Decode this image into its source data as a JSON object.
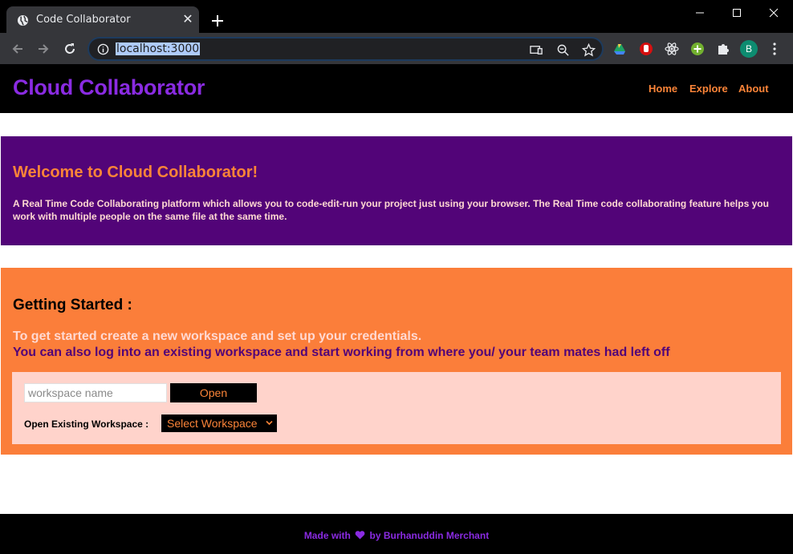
{
  "browser": {
    "tab_title": "Code Collaborator",
    "url": "localhost:3000",
    "profile_initial": "B"
  },
  "header": {
    "brand": "Cloud Collaborator",
    "nav": [
      "Home",
      "Explore",
      "About"
    ]
  },
  "welcome": {
    "title": "Welcome to Cloud Collaborator!",
    "text": "A Real Time Code Collaborating platform which allows you to code-edit-run your project just using your browser. The Real Time code collaborating feature helps you work with multiple people on the same file at the same time."
  },
  "getting_started": {
    "title": "Getting Started :",
    "line1": "To get started create a new workspace and set up your credentials.",
    "line2": "You can also log into an existing workspace and start working from where you/ your team mates had left off",
    "input_placeholder": "workspace name",
    "open_label": "Open",
    "existing_label": "Open Existing Workspace :",
    "select_value": "Select Workspace"
  },
  "footer": {
    "made_with": "Made with",
    "by": "by Burhanuddin Merchant"
  },
  "colors": {
    "purple": "#8a2be2",
    "deep_purple": "#520478",
    "orange": "#fb8438",
    "peach": "#ffd3cb"
  }
}
